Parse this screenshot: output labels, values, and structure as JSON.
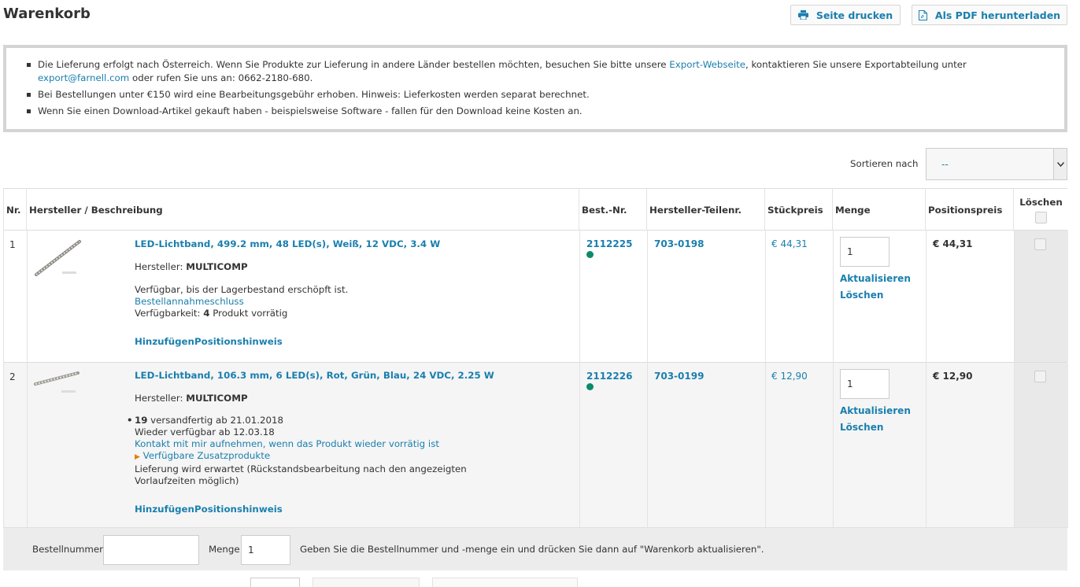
{
  "page": {
    "title": "Warenkorb"
  },
  "toolbar": {
    "print_label": "Seite drucken",
    "pdf_label": "Als PDF herunterladen"
  },
  "notice": {
    "line1_a": "Die Lieferung erfolgt nach Österreich. Wenn Sie Produkte zur Lieferung in andere Länder bestellen möchten, besuchen Sie bitte unsere ",
    "line1_link1": "Export-Webseite",
    "line1_b": ", kontaktieren Sie unsere Exportabteilung unter ",
    "line1_link2": "export@farnell.com",
    "line1_c": " oder rufen Sie uns an: 0662-2180-680.",
    "line2": "Bei Bestellungen unter €150 wird eine Bearbeitungsgebühr erhoben. Hinweis: Lieferkosten werden separat berechnet.",
    "line3": "Wenn Sie einen Download-Artikel gekauft haben - beispielsweise Software - fallen für den Download keine Kosten an."
  },
  "sort": {
    "label": "Sortieren nach",
    "value": "--"
  },
  "table": {
    "headers": {
      "nr": "Nr.",
      "desc": "Hersteller / Beschreibung",
      "order_no": "Best.-Nr.",
      "mfr_part": "Hersteller-Teilenr.",
      "unit_price": "Stückpreis",
      "qty": "Menge",
      "line_price": "Positionspreis",
      "delete": "Löschen"
    },
    "rows": [
      {
        "nr": "1",
        "title": "LED-Lichtband, 499.2 mm, 48 LED(s), Weiß, 12 VDC, 3.4 W",
        "mfr_label": "Hersteller: ",
        "mfr": "MULTICOMP",
        "avail1": "Verfügbar, bis der Lagerbestand erschöpft ist.",
        "cutoff_link": "Bestellannahmeschluss",
        "avail_label": "Verfügbarkeit: ",
        "avail_count": "4",
        "avail_suffix": " Produkt vorrätig",
        "add_note": "HinzufügenPositionshinweis",
        "order_no": "2112225",
        "mfr_part": "703-0198",
        "unit_price": "€ 44,31",
        "qty": "1",
        "update": "Aktualisieren",
        "remove": "Löschen",
        "line_price": "€ 44,31"
      },
      {
        "nr": "2",
        "title": "LED-Lichtband, 106.3 mm, 6 LED(s), Rot, Grün, Blau, 24 VDC, 2.25 W",
        "mfr_label": "Hersteller: ",
        "mfr": "MULTICOMP",
        "ship_count": "19",
        "ship_text": " versandfertig ab 21.01.2018",
        "restock": "Wieder verfügbar ab 12.03.18",
        "contact_link": "Kontakt mit mir aufnehmen, wenn das Produkt wieder vorrätig ist",
        "addon_link": "Verfügbare Zusatzprodukte",
        "backorder": "Lieferung wird erwartet (Rückstandsbearbeitung nach den angezeigten",
        "backorder2": "Vorlaufzeiten möglich)",
        "add_note": "HinzufügenPositionshinweis",
        "order_no": "2112226",
        "mfr_part": "703-0199",
        "unit_price": "€ 12,90",
        "qty": "1",
        "update": "Aktualisieren",
        "remove": "Löschen",
        "line_price": "€ 12,90"
      }
    ]
  },
  "quick_order": {
    "order_label": "Bestellnummer",
    "order_value": "",
    "qty_label": "Menge",
    "qty_value": "1",
    "hint": "Geben Sie die Bestellnummer und -menge ein und drücken Sie dann auf \"Warenkorb aktualisieren\"."
  },
  "colors": {
    "link": "#1a7fae",
    "stock_dot": "#0c8a6b",
    "notice_border": "#d4d4d4"
  }
}
